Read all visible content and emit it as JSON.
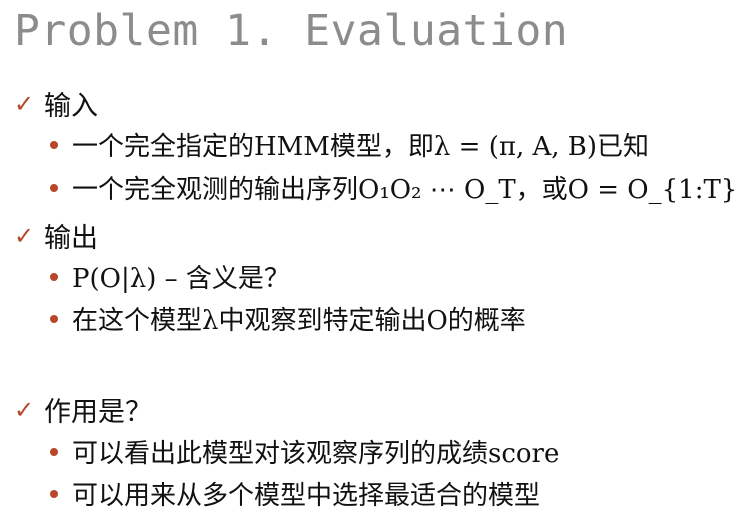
{
  "title": "Problem 1. Evaluation",
  "accent_color": "#b8462a",
  "sections": [
    {
      "heading": "输入",
      "items": [
        "一个完全指定的HMM模型，即λ = (π, A, B)已知",
        "一个完全观测的输出序列O₁O₂ ⋯ O_T，或O = O_{1:T}"
      ]
    },
    {
      "heading": "输出",
      "items": [
        "P(O|λ)  –  含义是？",
        "在这个模型λ中观察到特定输出O的概率"
      ]
    },
    {
      "heading": "作用是？",
      "items": [
        "可以看出此模型对该观察序列的成绩score",
        "可以用来从多个模型中选择最适合的模型"
      ]
    }
  ]
}
